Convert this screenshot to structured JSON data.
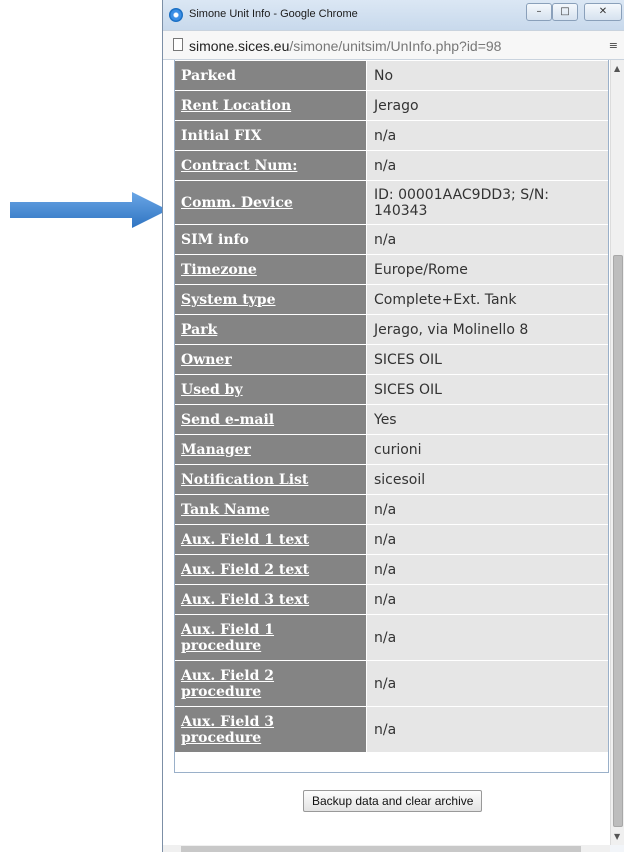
{
  "window": {
    "title": "Simone Unit Info - Google Chrome",
    "url_host": "simone.sices.eu",
    "url_path": "/simone/unitsim/UnInfo.php?id=98",
    "min_glyph": "–",
    "max_glyph": "□",
    "close_glyph": "✕"
  },
  "rows": [
    {
      "label": "Parked",
      "value": "No",
      "link": false
    },
    {
      "label": "Rent Location",
      "value": "Jerago",
      "link": true
    },
    {
      "label": "Initial FIX",
      "value": "n/a",
      "link": false
    },
    {
      "label": "Contract Num:",
      "value": "n/a",
      "link": true
    },
    {
      "label": "Comm. Device",
      "value": "ID: 00001AAC9DD3; S/N: 140343",
      "link": true
    },
    {
      "label": "SIM info",
      "value": "n/a",
      "link": false
    },
    {
      "label": "Timezone",
      "value": "Europe/Rome",
      "link": true
    },
    {
      "label": "System type",
      "value": "Complete+Ext. Tank",
      "link": true
    },
    {
      "label": "Park",
      "value": "Jerago, via Molinello 8",
      "link": true
    },
    {
      "label": "Owner",
      "value": "SICES OIL",
      "link": true
    },
    {
      "label": "Used by",
      "value": "SICES OIL",
      "link": true
    },
    {
      "label": "Send e-mail",
      "value": "Yes",
      "link": true
    },
    {
      "label": "Manager",
      "value": "curioni",
      "link": true
    },
    {
      "label": "Notification List",
      "value": "sicesoil",
      "link": true
    },
    {
      "label": "Tank Name",
      "value": "n/a",
      "link": true
    },
    {
      "label": "Aux. Field 1 text",
      "value": "n/a",
      "link": true
    },
    {
      "label": "Aux. Field 2 text",
      "value": "n/a",
      "link": true
    },
    {
      "label": "Aux. Field 3 text",
      "value": "n/a",
      "link": true
    },
    {
      "label": "Aux. Field 1 procedure",
      "value": "n/a",
      "link": true
    },
    {
      "label": "Aux. Field 2 procedure",
      "value": "n/a",
      "link": true
    },
    {
      "label": "Aux. Field 3 procedure",
      "value": "n/a",
      "link": true
    }
  ],
  "actions": {
    "backup_label": "Backup data and clear archive"
  },
  "colors": {
    "label_bg": "#848484",
    "value_bg": "#e6e6e6",
    "arrow": "#3d86d4"
  }
}
